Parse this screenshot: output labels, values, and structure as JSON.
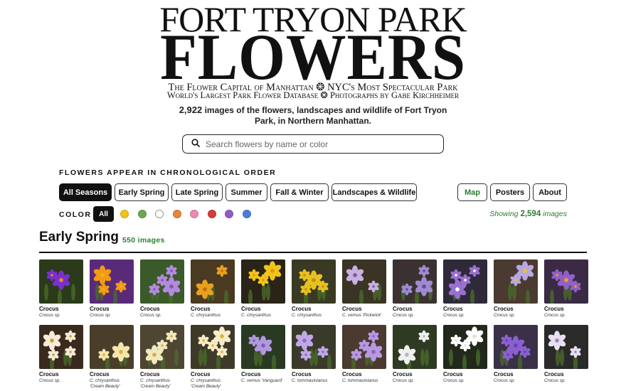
{
  "masthead": {
    "title_top": "FORT TRYON PARK",
    "title_main": "FLOWERS",
    "tagline1_a": "The Flower Capital of Manhattan",
    "tagline1_b": "NYC's Most Spectacular Park",
    "tagline2_a": "World's Largest Park Flower Database",
    "tagline2_b": "Photographs by Gabe Kirchheimer",
    "separator": "❂"
  },
  "intro": {
    "count": "2,922",
    "text": "images of the flowers, landscapes and wildlife of Fort Tryon Park, in Northern Manhattan."
  },
  "search": {
    "placeholder": "Search flowers by name or color",
    "icon": "search-icon"
  },
  "filters": {
    "heading": "FLOWERS APPEAR IN CHRONOLOGICAL ORDER",
    "seasons": [
      "All Seasons",
      "Early Spring",
      "Late Spring",
      "Summer",
      "Fall & Winter",
      "Landscapes & Wildlife"
    ],
    "active_season": "All Seasons",
    "nav": [
      "Map",
      "Posters",
      "About"
    ],
    "color_label": "COLOR",
    "color_all": "All",
    "colors": [
      "#f0c419",
      "#6aa84f",
      "#ffffff",
      "#e8863a",
      "#e98bb5",
      "#d93b3b",
      "#8e5cc8",
      "#4a7fd4"
    ],
    "showing_prefix": "Showing",
    "showing_count": "2,594",
    "showing_suffix": "images"
  },
  "section": {
    "title": "Early Spring",
    "count": "550 images"
  },
  "flowers": [
    {
      "name": "Crocus",
      "sci": "Crocus sp.",
      "sci2": "",
      "petal": "#7a2fd0",
      "center": "#f08a10",
      "bg": "#2a3a1a"
    },
    {
      "name": "Crocus",
      "sci": "Crocus sp.",
      "sci2": "",
      "petal": "#f29a14",
      "center": "#f2b020",
      "bg": "#5a2a7a"
    },
    {
      "name": "Crocus",
      "sci": "Crocus sp.",
      "sci2": "",
      "petal": "#b48ae0",
      "center": "#7e5aa8",
      "bg": "#3a5a2a"
    },
    {
      "name": "Crocus",
      "sci": "C. chrysanthus",
      "sci2": "",
      "petal": "#e8a020",
      "center": "#c07010",
      "bg": "#4a3a22"
    },
    {
      "name": "Crocus",
      "sci": "C. chrysanthus",
      "sci2": "",
      "petal": "#f2c41a",
      "center": "#d89a10",
      "bg": "#2a2418"
    },
    {
      "name": "Crocus",
      "sci": "C. chrysanthus",
      "sci2": "",
      "petal": "#e8c020",
      "center": "#c09010",
      "bg": "#3a3a24"
    },
    {
      "name": "Crocus",
      "sci": "C. vernus 'Pickwick'",
      "sci2": "",
      "petal": "#c8b0e0",
      "center": "#7a5aa0",
      "bg": "#3a3424"
    },
    {
      "name": "Crocus",
      "sci": "Crocus sp.",
      "sci2": "",
      "petal": "#a08ad0",
      "center": "#6a4a9a",
      "bg": "#3a3230"
    },
    {
      "name": "Crocus",
      "sci": "Crocus sp.",
      "sci2": "",
      "petal": "#9a70d0",
      "center": "#ffffff",
      "bg": "#2e2a3a"
    },
    {
      "name": "Crocus",
      "sci": "Crocus sp.",
      "sci2": "",
      "petal": "#b8a8e0",
      "center": "#f0c020",
      "bg": "#4a3a30"
    },
    {
      "name": "Crocus",
      "sci": "Crocus sp.",
      "sci2": "",
      "petal": "#9060c8",
      "center": "#f0a020",
      "bg": "#3a2a44"
    },
    {
      "name": "Crocus",
      "sci": "Crocus sp.",
      "sci2": "",
      "petal": "#f4ecd8",
      "center": "#d0a030",
      "bg": "#3a2a1e"
    },
    {
      "name": "Crocus",
      "sci": "C. chrysanthus",
      "sci2": "'Cream Beauty'",
      "petal": "#f5e6b0",
      "center": "#e0b030",
      "bg": "#4a3e2a"
    },
    {
      "name": "Crocus",
      "sci": "C. chrysanthus",
      "sci2": "'Cream Beauty'",
      "petal": "#f2e8c0",
      "center": "#d8b040",
      "bg": "#4e4632"
    },
    {
      "name": "Crocus",
      "sci": "C. chrysanthus",
      "sci2": "'Cream Beauty'",
      "petal": "#f6ecc8",
      "center": "#e0b040",
      "bg": "#3e3a2a"
    },
    {
      "name": "Crocus",
      "sci": "C. vernus 'Vanguard'",
      "sci2": "",
      "petal": "#b098e0",
      "center": "#7a60b0",
      "bg": "#2a3a22"
    },
    {
      "name": "Crocus",
      "sci": "C. tommasinianus",
      "sci2": "",
      "petal": "#c0a8e8",
      "center": "#8a70c0",
      "bg": "#3a3a2a"
    },
    {
      "name": "Crocus",
      "sci": "C. tommasinianus",
      "sci2": "",
      "petal": "#b898e0",
      "center": "#8468b8",
      "bg": "#4a3a30"
    },
    {
      "name": "Crocus",
      "sci": "Crocus sp.",
      "sci2": "",
      "petal": "#f0f0f0",
      "center": "#b8b8b8",
      "bg": "#2e3a22"
    },
    {
      "name": "Crocus",
      "sci": "Crocus sp.",
      "sci2": "",
      "petal": "#ffffff",
      "center": "#e0e0e0",
      "bg": "#22281c"
    },
    {
      "name": "Crocus",
      "sci": "Crocus sp.",
      "sci2": "",
      "petal": "#8a60d0",
      "center": "#6a40b0",
      "bg": "#3a3048"
    },
    {
      "name": "Crocus",
      "sci": "Crocus sp.",
      "sci2": "",
      "petal": "#e8e0f0",
      "center": "#9a8ab8",
      "bg": "#2a2a2a"
    }
  ]
}
